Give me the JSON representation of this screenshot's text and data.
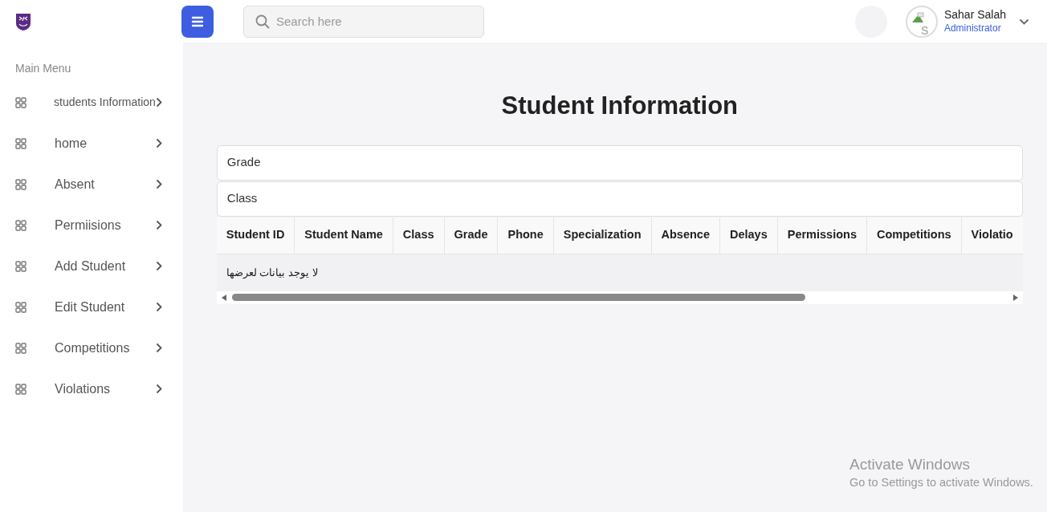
{
  "header": {
    "search": {
      "placeholder": "Search here"
    },
    "user": {
      "name": "Sahar Salah",
      "role": "Administrator",
      "avatar_alt": "S"
    }
  },
  "sidebar": {
    "heading": "Main Menu",
    "items": [
      {
        "label": "students Information"
      },
      {
        "label": "home"
      },
      {
        "label": "Absent"
      },
      {
        "label": "Permiisions"
      },
      {
        "label": "Add Student"
      },
      {
        "label": "Edit Student"
      },
      {
        "label": "Competitions"
      },
      {
        "label": "Violations"
      }
    ]
  },
  "page": {
    "title": "Student Information",
    "filters": [
      {
        "label": "Grade"
      },
      {
        "label": "Class"
      }
    ],
    "table": {
      "columns": [
        "Student ID",
        "Student Name",
        "Class",
        "Grade",
        "Phone",
        "Specialization",
        "Absence",
        "Delays",
        "Permissions",
        "Competitions",
        "Violatio"
      ],
      "empty_message": "لا يوجد بيانات لعرضها"
    }
  },
  "os_notice": {
    "title": "Activate Windows",
    "subtitle": "Go to Settings to activate Windows."
  }
}
